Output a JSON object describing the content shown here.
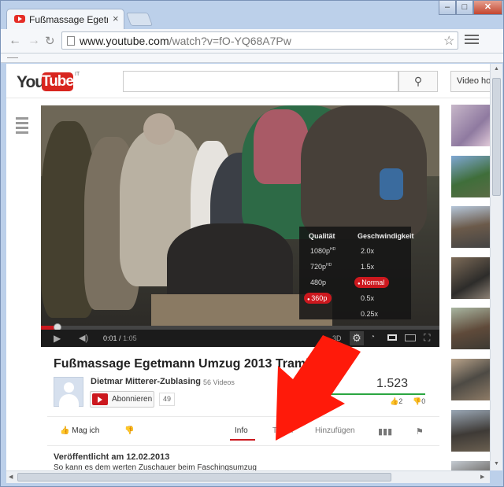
{
  "browser": {
    "tab_title": "Fußmassage Egetmann U",
    "tab_close": "×",
    "url_host": "www.youtube.com",
    "url_rest": "/watch?v=fO-YQ68A7Pw",
    "win_min": "–",
    "win_max": "□",
    "win_close": "✕"
  },
  "youtube": {
    "logo_you": "You",
    "logo_tube": "Tube",
    "logo_region": "IT",
    "upload_label": "Video hoc"
  },
  "player": {
    "time_current": "0:01",
    "time_sep": "/",
    "time_total": "1:05",
    "badge_3d": "3D",
    "progress_fraction": 0.015,
    "settings": {
      "quality_header": "Qualität",
      "speed_header": "Geschwindigkeit",
      "quality_options": [
        "1080p",
        "720p",
        "480p",
        "360p"
      ],
      "hd_tag": "HD",
      "quality_selected": "360p",
      "speed_options": [
        "2.0x",
        "1.5x",
        "Normal",
        "0.5x",
        "0.25x"
      ],
      "speed_selected": "Normal"
    }
  },
  "video_info": {
    "title": "Fußmassage Egetmann Umzug 2013 Tramin",
    "channel": "Dietmar Mitterer-Zublasing",
    "video_count": "56 Videos",
    "subscribe_label": "Abonnieren",
    "subscriber_count": "49",
    "views": "1.523",
    "likes": "2",
    "dislikes": "0",
    "like_fraction": 1.0
  },
  "actions": {
    "like_label": "Mag ich",
    "tab_info": "Info",
    "tab_share": "Teilen",
    "tab_add": "Hinzufügen"
  },
  "description": {
    "published": "Veröffentlicht am 12.02.2013",
    "text": "So kann es dem werten Zuschauer beim Faschingsumzug"
  },
  "colors": {
    "brand_red": "#cc181e",
    "annotation_arrow": "#ff1a0a",
    "like_green": "#2ba640"
  }
}
